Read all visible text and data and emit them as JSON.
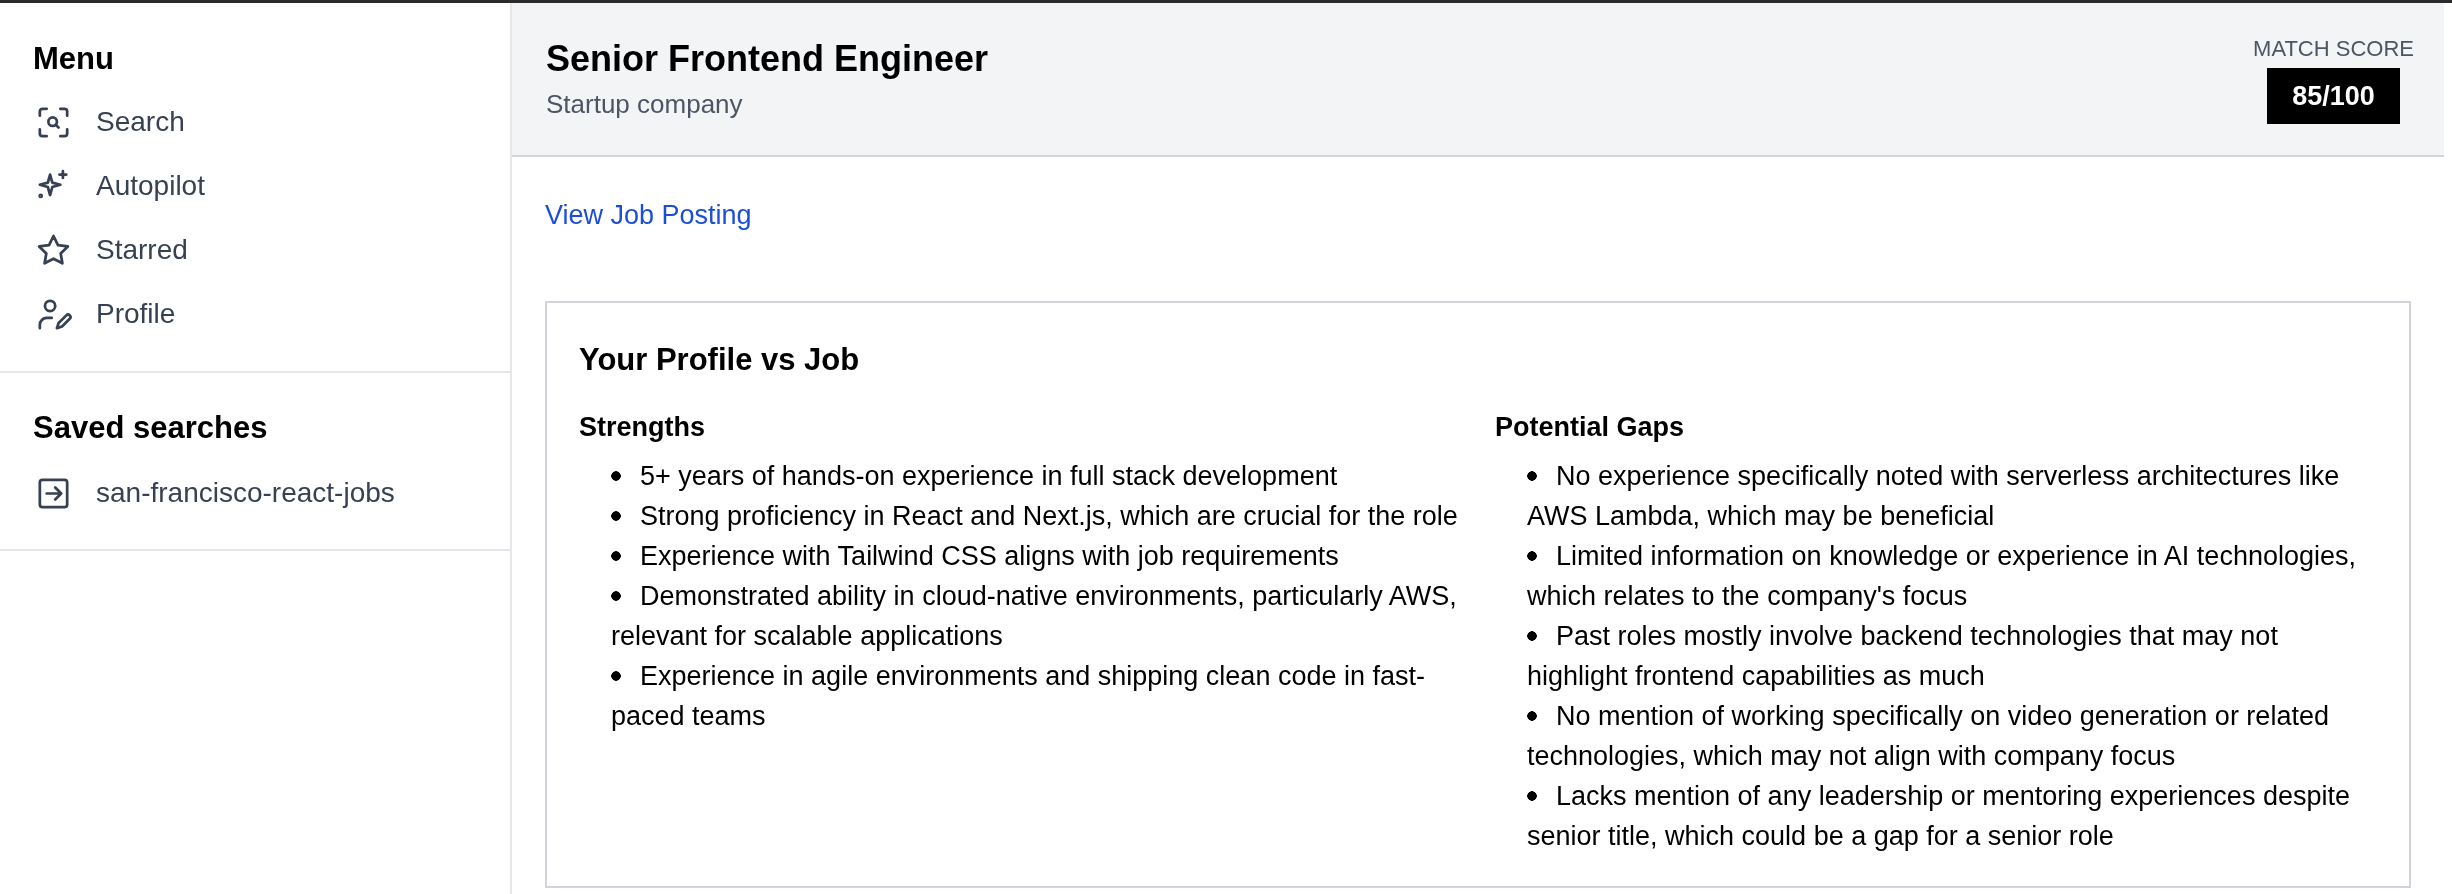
{
  "sidebar": {
    "menu_title": "Menu",
    "items": [
      {
        "label": "Search"
      },
      {
        "label": "Autopilot"
      },
      {
        "label": "Starred"
      },
      {
        "label": "Profile"
      }
    ],
    "saved_title": "Saved searches",
    "saved_searches": [
      {
        "label": "san-francisco-react-jobs"
      }
    ]
  },
  "header": {
    "title": "Senior Frontend Engineer",
    "subtitle": "Startup company",
    "score_label": "MATCH SCORE",
    "score": "85/100"
  },
  "link": "View Job Posting",
  "comparison": {
    "title": "Your Profile vs Job",
    "columns": [
      {
        "heading": "Strengths",
        "items": [
          "5+ years of hands-on experience in full stack development",
          "Strong proficiency in React and Next.js, which are crucial for the role",
          "Experience with Tailwind CSS aligns with job requirements",
          "Demonstrated ability in cloud-native environments, particularly AWS, relevant for scalable applications",
          "Experience in agile environments and shipping clean code in fast-paced teams"
        ]
      },
      {
        "heading": "Potential Gaps",
        "items": [
          "No experience specifically noted with serverless architectures like AWS Lambda, which may be beneficial",
          "Limited information on knowledge or experience in AI technologies, which relates to the company's focus",
          "Past roles mostly involve backend technologies that may not highlight frontend capabilities as much",
          "No mention of working specifically on video generation or related technologies, which may not align with company focus",
          "Lacks mention of any leadership or mentoring experiences despite senior title, which could be a gap for a senior role"
        ]
      }
    ]
  }
}
